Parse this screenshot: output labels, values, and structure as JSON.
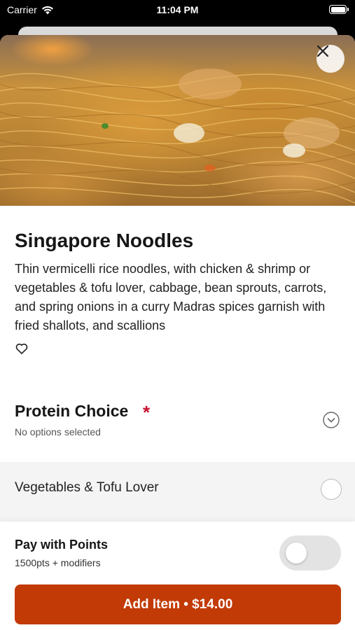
{
  "status_bar": {
    "carrier": "Carrier",
    "time": "11:04 PM"
  },
  "item": {
    "title": "Singapore Noodles",
    "description": "Thin vermicelli rice noodles, with chicken & shrimp or vegetables & tofu lover, cabbage, bean sprouts, carrots, and spring onions in a curry Madras spices garnish with fried shallots, and scallions",
    "favorite_icon": "heart-outline-icon"
  },
  "protein_section": {
    "title": "Protein Choice",
    "required_mark": "*",
    "subtitle": "No options selected",
    "options": [
      {
        "label": "Vegetables & Tofu Lover",
        "selected": false
      }
    ]
  },
  "footer": {
    "points_title": "Pay with Points",
    "points_subtitle": "1500pts + modifiers",
    "points_toggle_on": false,
    "add_button_label": "Add Item • $14.00"
  },
  "colors": {
    "accent": "#c23a06",
    "required": "#c8102e"
  }
}
